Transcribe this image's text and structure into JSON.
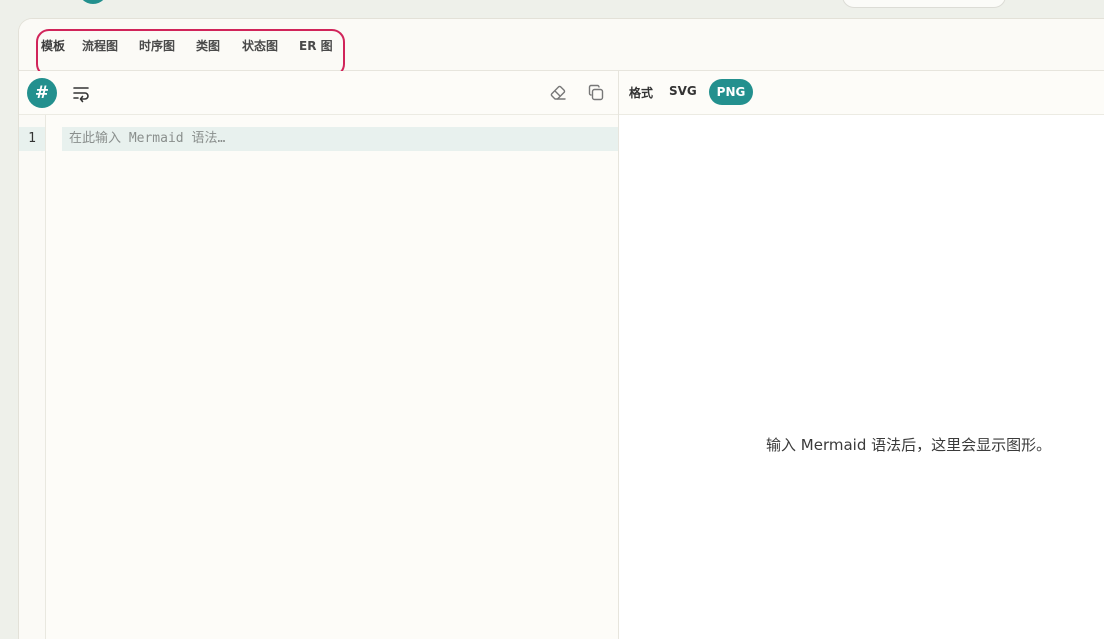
{
  "templates": {
    "label": "模板",
    "tabs": [
      {
        "label": "流程图"
      },
      {
        "label": "时序图"
      },
      {
        "label": "类图"
      },
      {
        "label": "状态图"
      },
      {
        "label": "ER 图"
      }
    ]
  },
  "editor": {
    "hash_button": "#",
    "line_number": "1",
    "placeholder": "在此输入 Mermaid 语法…"
  },
  "preview": {
    "format_label": "格式",
    "formats": [
      "SVG",
      "PNG"
    ],
    "selected_format": "PNG",
    "empty_message": "输入 Mermaid 语法后，这里会显示图形。"
  },
  "colors": {
    "accent": "#23908e",
    "highlight": "#d1245a"
  }
}
